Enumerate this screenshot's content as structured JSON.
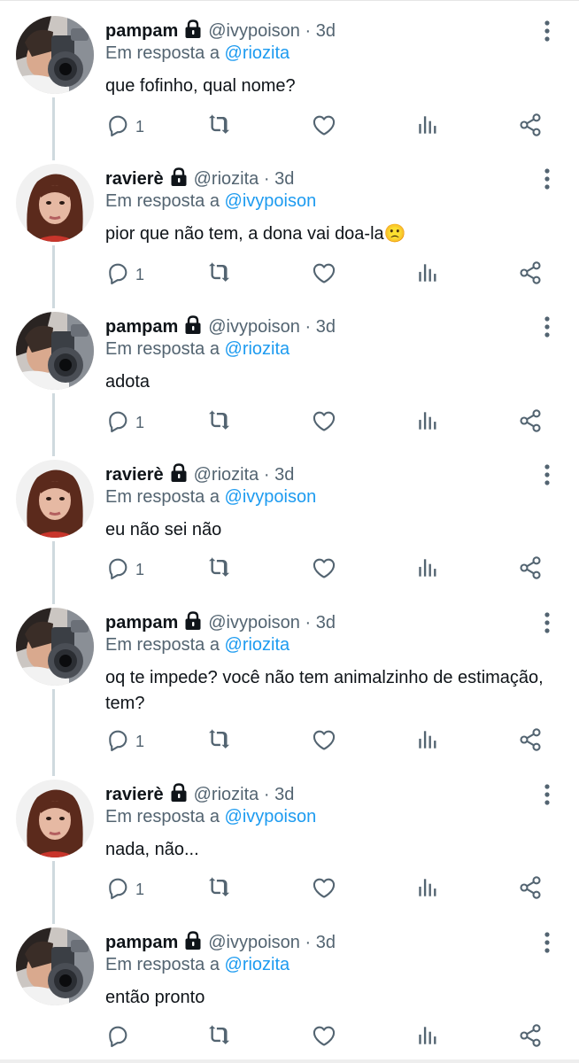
{
  "tweets": [
    {
      "user": "pampam",
      "handle": "@ivypoison",
      "time": "3d",
      "reply_prefix": "Em resposta a",
      "reply_to": "@riozita",
      "text": "que fofinho, qual nome?",
      "reply_count": "1",
      "avatar_icon": "avatar-gun-pampam"
    },
    {
      "user": "ravierè",
      "handle": "@riozita",
      "time": "3d",
      "reply_prefix": "Em resposta a",
      "reply_to": "@ivypoison",
      "text": "pior que não tem, a dona vai doa-la🙁",
      "reply_count": "1",
      "avatar_icon": "avatar-woman-raviere"
    },
    {
      "user": "pampam",
      "handle": "@ivypoison",
      "time": "3d",
      "reply_prefix": "Em resposta a",
      "reply_to": "@riozita",
      "text": "adota",
      "reply_count": "1",
      "avatar_icon": "avatar-gun-pampam"
    },
    {
      "user": "ravierè",
      "handle": "@riozita",
      "time": "3d",
      "reply_prefix": "Em resposta a",
      "reply_to": "@ivypoison",
      "text": "eu não sei não",
      "reply_count": "1",
      "avatar_icon": "avatar-woman-raviere"
    },
    {
      "user": "pampam",
      "handle": "@ivypoison",
      "time": "3d",
      "reply_prefix": "Em resposta a",
      "reply_to": "@riozita",
      "text": "oq te impede? você não tem animalzinho de estimação, tem?",
      "reply_count": "1",
      "avatar_icon": "avatar-gun-pampam"
    },
    {
      "user": "ravierè",
      "handle": "@riozita",
      "time": "3d",
      "reply_prefix": "Em resposta a",
      "reply_to": "@ivypoison",
      "text": "nada, não...",
      "reply_count": "1",
      "avatar_icon": "avatar-woman-raviere"
    },
    {
      "user": "pampam",
      "handle": "@ivypoison",
      "time": "3d",
      "reply_prefix": "Em resposta a",
      "reply_to": "@riozita",
      "text": "então pronto",
      "reply_count": "",
      "avatar_icon": "avatar-gun-pampam"
    }
  ],
  "separator": "·",
  "icons": {
    "lock": "lock-icon",
    "more": "more-vertical-icon",
    "reply": "reply-icon",
    "retweet": "retweet-icon",
    "like": "heart-icon",
    "views": "analytics-icon",
    "share": "share-icon"
  },
  "colors": {
    "text": "#0f1419",
    "secondary": "#536471",
    "link": "#1d9bf0",
    "thread_line": "#cfd9de"
  }
}
